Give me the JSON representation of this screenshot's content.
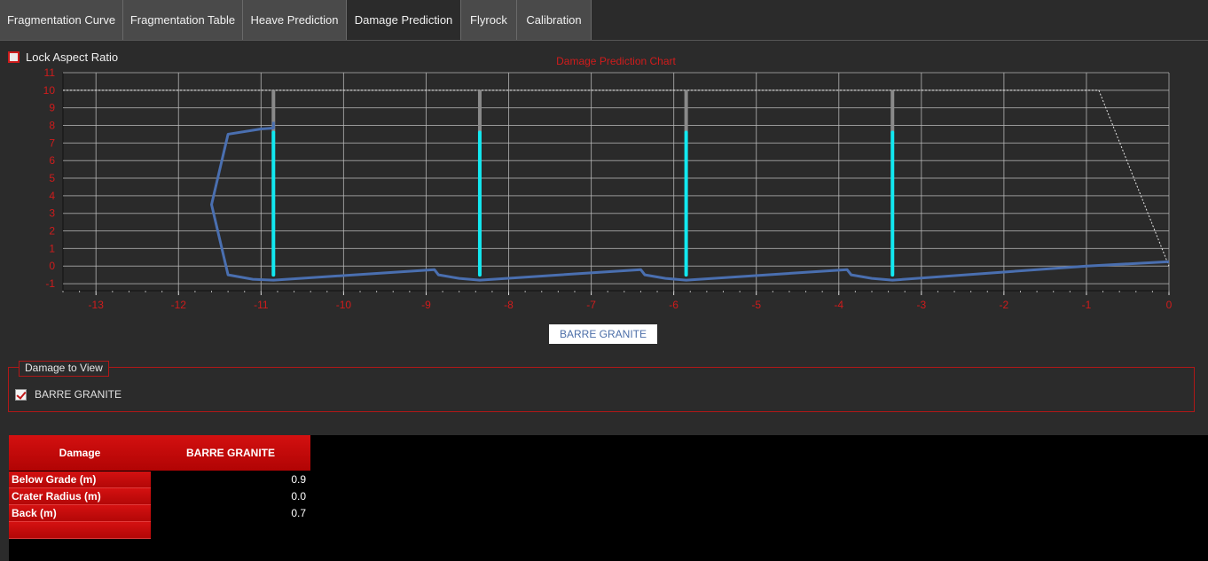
{
  "tabs": [
    {
      "label": "Fragmentation Curve",
      "active": false
    },
    {
      "label": "Fragmentation Table",
      "active": false
    },
    {
      "label": "Heave Prediction",
      "active": false
    },
    {
      "label": "Damage Prediction",
      "active": true
    },
    {
      "label": "Flyrock",
      "active": false
    },
    {
      "label": "Calibration",
      "active": false
    }
  ],
  "lock_aspect_ratio": {
    "label": "Lock Aspect Ratio",
    "checked": false
  },
  "chart_data": {
    "type": "line",
    "title": "Damage Prediction Chart",
    "xlim": [
      -13.4,
      0
    ],
    "ylim": [
      -1.4,
      11
    ],
    "x_ticks": [
      -13,
      -12,
      -11,
      -10,
      -9,
      -8,
      -7,
      -6,
      -5,
      -4,
      -3,
      -2,
      -1,
      0
    ],
    "y_ticks": [
      -1,
      0,
      1,
      2,
      3,
      4,
      5,
      6,
      7,
      8,
      9,
      10,
      11
    ],
    "grid": true,
    "series": [
      {
        "name": "BARRE GRANITE",
        "color": "#4a6fb0",
        "x": [
          -10.85,
          -10.85,
          -11.0,
          -11.4,
          -11.6,
          -11.4,
          -11.1,
          -10.85,
          -8.9,
          -8.85,
          -8.6,
          -8.35,
          -6.4,
          -6.35,
          -6.1,
          -5.85,
          -3.9,
          -3.85,
          -3.6,
          -3.35,
          -1.0,
          0.0
        ],
        "y": [
          8.2,
          7.85,
          7.8,
          7.5,
          3.5,
          -0.5,
          -0.75,
          -0.8,
          -0.2,
          -0.5,
          -0.7,
          -0.8,
          -0.2,
          -0.5,
          -0.7,
          -0.8,
          -0.2,
          -0.5,
          -0.7,
          -0.8,
          0.0,
          0.25
        ]
      }
    ],
    "holes": [
      {
        "x": -10.85,
        "stemming_top": 10.0,
        "charge_top": 7.6,
        "bottom": -0.5
      },
      {
        "x": -8.35,
        "stemming_top": 10.0,
        "charge_top": 7.6,
        "bottom": -0.5
      },
      {
        "x": -5.85,
        "stemming_top": 10.0,
        "charge_top": 7.6,
        "bottom": -0.5
      },
      {
        "x": -3.35,
        "stemming_top": 10.0,
        "charge_top": 7.6,
        "bottom": -0.5
      }
    ],
    "bench_profile": {
      "x": [
        -13.4,
        -0.85,
        0.0
      ],
      "y": [
        10,
        10,
        0
      ]
    },
    "colors": {
      "axis_text": "#d01c1c",
      "charge": "#12e8f0",
      "stemming": "#8a8a8a",
      "grid": "#bdbdbd",
      "plot_bg": "#2a2a2a"
    },
    "legend": {
      "label": "BARRE GRANITE",
      "position": "bottom-center"
    }
  },
  "damage_to_view": {
    "title": "Damage to View",
    "items": [
      {
        "label": "BARRE GRANITE",
        "checked": true
      }
    ]
  },
  "results_table": {
    "headers": [
      "Damage",
      "BARRE GRANITE"
    ],
    "rows": [
      {
        "label": "Below Grade (m)",
        "value": "0.9"
      },
      {
        "label": "Crater Radius (m)",
        "value": "0.0"
      },
      {
        "label": "Back (m)",
        "value": "0.7"
      },
      {
        "label": "",
        "value": ""
      }
    ]
  }
}
